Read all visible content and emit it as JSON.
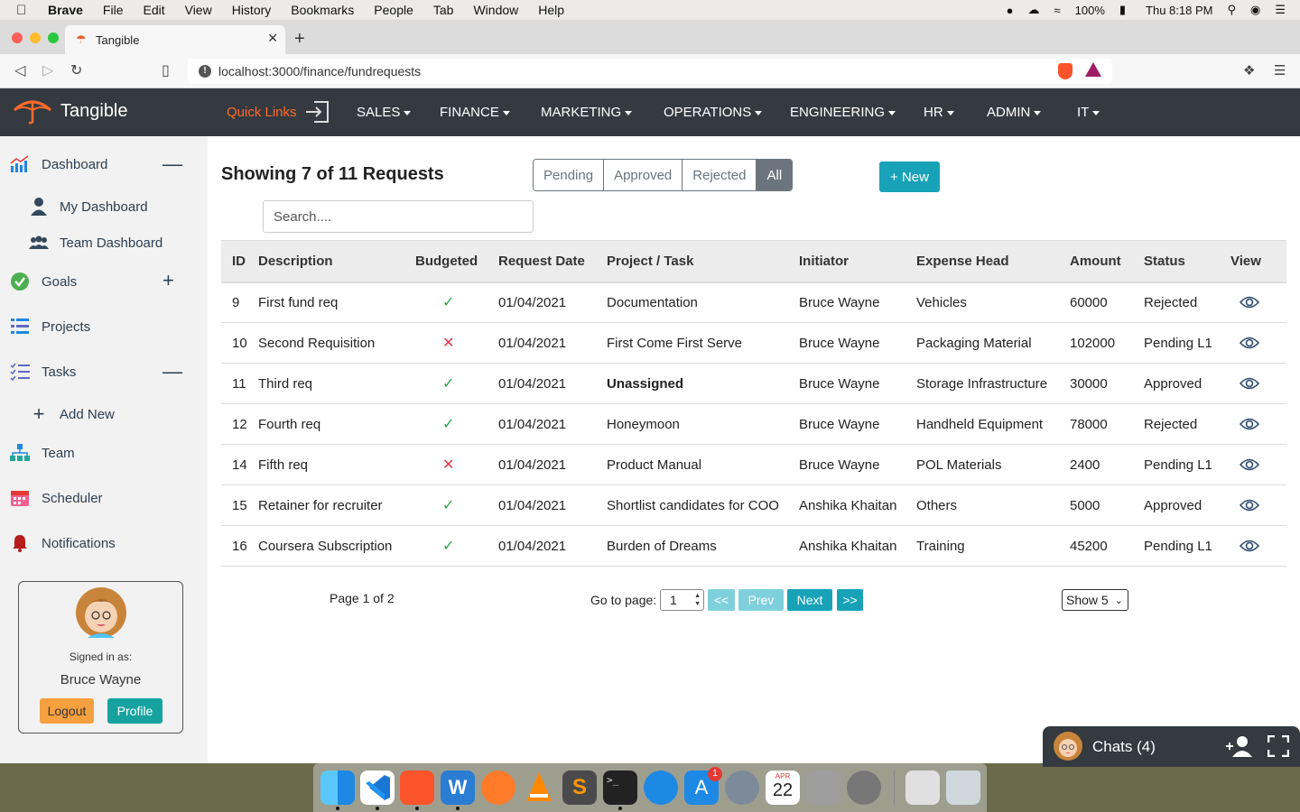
{
  "menubar": {
    "app": "Brave",
    "items": [
      "File",
      "Edit",
      "View",
      "History",
      "Bookmarks",
      "People",
      "Tab",
      "Window",
      "Help"
    ],
    "battery": "100%",
    "clock": "Thu 8:18 PM"
  },
  "browser": {
    "tab_title": "Tangible",
    "url": "localhost:3000/finance/fundrequests"
  },
  "nav": {
    "brand": "Tangible",
    "quick_links": "Quick Links",
    "menus": [
      "SALES",
      "FINANCE",
      "MARKETING",
      "OPERATIONS",
      "ENGINEERING",
      "HR",
      "ADMIN",
      "IT"
    ]
  },
  "sidebar": {
    "dashboard": "Dashboard",
    "my_dashboard": "My Dashboard",
    "team_dashboard": "Team Dashboard",
    "goals": "Goals",
    "projects": "Projects",
    "tasks": "Tasks",
    "add_new": "Add New",
    "team": "Team",
    "scheduler": "Scheduler",
    "notifications": "Notifications",
    "signed_in_as": "Signed in as:",
    "user_name": "Bruce Wayne",
    "logout": "Logout",
    "profile": "Profile"
  },
  "main": {
    "heading": "Showing 7 of 11 Requests",
    "filters": [
      "Pending",
      "Approved",
      "Rejected",
      "All"
    ],
    "active_filter": "All",
    "new_button": "+ New",
    "search_placeholder": "Search...."
  },
  "table": {
    "headers": [
      "ID",
      "Description",
      "Budgeted",
      "Request Date",
      "Project / Task",
      "Initiator",
      "Expense Head",
      "Amount",
      "Status",
      "View"
    ],
    "rows": [
      {
        "id": "9",
        "description": "First fund req",
        "budgeted": true,
        "date": "01/04/2021",
        "project": "Documentation",
        "initiator": "Bruce Wayne",
        "expense": "Vehicles",
        "amount": "60000",
        "status": "Rejected"
      },
      {
        "id": "10",
        "description": "Second Requisition",
        "budgeted": false,
        "date": "01/04/2021",
        "project": "First Come First Serve",
        "initiator": "Bruce Wayne",
        "expense": "Packaging Material",
        "amount": "102000",
        "status": "Pending L1"
      },
      {
        "id": "11",
        "description": "Third req",
        "budgeted": true,
        "date": "01/04/2021",
        "project": "Unassigned",
        "initiator": "Bruce Wayne",
        "expense": "Storage Infrastructure",
        "amount": "30000",
        "status": "Approved"
      },
      {
        "id": "12",
        "description": "Fourth req",
        "budgeted": true,
        "date": "01/04/2021",
        "project": "Honeymoon",
        "initiator": "Bruce Wayne",
        "expense": "Handheld Equipment",
        "amount": "78000",
        "status": "Rejected"
      },
      {
        "id": "14",
        "description": "Fifth req",
        "budgeted": false,
        "date": "01/04/2021",
        "project": "Product Manual",
        "initiator": "Bruce Wayne",
        "expense": "POL Materials",
        "amount": "2400",
        "status": "Pending L1"
      },
      {
        "id": "15",
        "description": "Retainer for recruiter",
        "budgeted": true,
        "date": "01/04/2021",
        "project": "Shortlist candidates for COO",
        "initiator": "Anshika Khaitan",
        "expense": "Others",
        "amount": "5000",
        "status": "Approved"
      },
      {
        "id": "16",
        "description": "Coursera Subscription",
        "budgeted": true,
        "date": "01/04/2021",
        "project": "Burden of Dreams",
        "initiator": "Anshika Khaitan",
        "expense": "Training",
        "amount": "45200",
        "status": "Pending L1"
      }
    ]
  },
  "pagination": {
    "page_info": "Page 1 of 2",
    "goto_label": "Go to page:",
    "page_value": "1",
    "first": "<<",
    "prev": "Prev",
    "next": "Next",
    "last": ">>",
    "show": "Show 5"
  },
  "chats": {
    "label": "Chats (4)"
  },
  "dock": {
    "calendar_month": "APR",
    "calendar_day": "22",
    "badge": "1"
  },
  "colors": {
    "navbar": "#343a40",
    "accent": "#17a2b8",
    "quicklinks": "#ff6a2a",
    "danger": "#dc3545",
    "success": "#28a745"
  }
}
